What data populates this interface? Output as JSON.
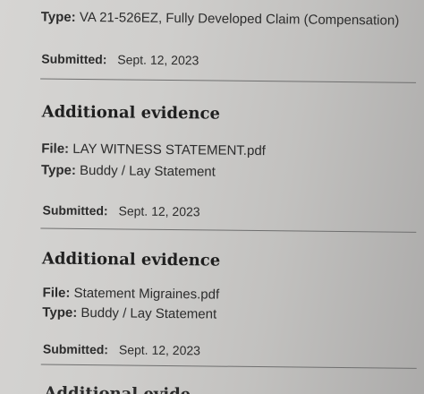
{
  "top_item": {
    "type_label": "Type:",
    "type_value": "VA 21-526EZ, Fully Developed Claim (Compensation)",
    "submitted_label": "Submitted:",
    "submitted_value": "Sept. 12, 2023"
  },
  "evidence_items": [
    {
      "heading": "Additional evidence",
      "file_label": "File:",
      "file_value": "LAY WITNESS STATEMENT.pdf",
      "type_label": "Type:",
      "type_value": "Buddy / Lay Statement",
      "submitted_label": "Submitted:",
      "submitted_value": "Sept. 12, 2023"
    },
    {
      "heading": "Additional evidence",
      "file_label": "File:",
      "file_value": "Statement Migraines.pdf",
      "type_label": "Type:",
      "type_value": "Buddy / Lay Statement",
      "submitted_label": "Submitted:",
      "submitted_value": "Sept. 12, 2023"
    }
  ],
  "partial_heading": "Additional evide"
}
